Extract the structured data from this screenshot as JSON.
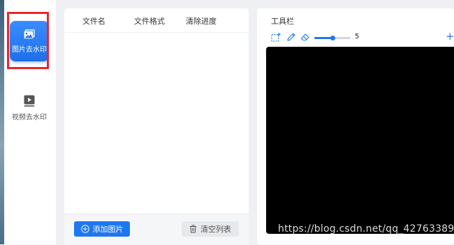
{
  "sidebar": {
    "items": [
      {
        "label": "图片去水印",
        "icon": "image-icon",
        "active": true
      },
      {
        "label": "视频去水印",
        "icon": "video-icon",
        "active": false
      }
    ]
  },
  "file_list": {
    "columns": [
      "文件名",
      "文件格式",
      "清除进度"
    ],
    "rows": [],
    "add_button": "添加图片",
    "clear_button": "清空列表"
  },
  "tools": {
    "title": "工具栏",
    "brush_size": 5,
    "brush_size_max": 10
  },
  "watermark": "https://blog.csdn.net/qq_42763389",
  "colors": {
    "accent": "#1e77f0",
    "highlight_box": "#e8262a",
    "canvas": "#000000"
  }
}
